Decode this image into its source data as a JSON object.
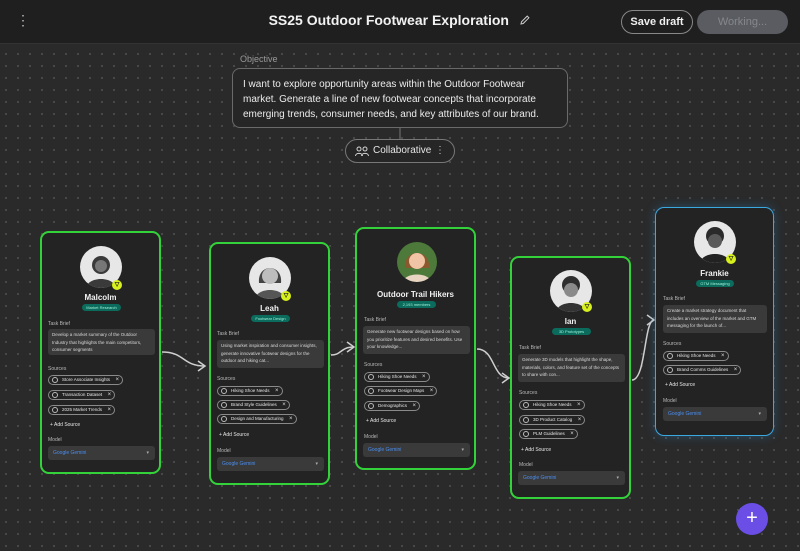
{
  "header": {
    "menu_icon": "more-vertical-icon",
    "title": "SS25 Outdoor Footwear Exploration",
    "edit_icon": "pencil-icon",
    "save_label": "Save draft",
    "working_label": "Working..."
  },
  "objective": {
    "label": "Objective",
    "text": "I want to explore opportunity areas within the Outdoor Footwear market. Generate a line of new footwear concepts that incorporate emerging trends, consumer needs, and  key attributes of our brand."
  },
  "mode": {
    "label": "Collaborative",
    "icon": "people-group-icon",
    "more_icon": "more-vertical-icon"
  },
  "labels": {
    "task_brief": "Task Brief",
    "sources": "Sources",
    "add_source": "+ Add Source",
    "model": "Model"
  },
  "agents": [
    {
      "name": "Malcolm",
      "role": "Market Research",
      "brief": "Develop a market summary of the Outdoor Industry that highlights the main competitors, consumer segments",
      "sources": [
        "Store Associate Insights",
        "Transaction Dataset",
        "2025 Market Trends"
      ],
      "model": "Google Gemini"
    },
    {
      "name": "Leah",
      "role": "Footwear Design",
      "brief": "Using market inspiration and consumer insights, generate innovative footwear designs for the outdoor and hiking cat...",
      "sources": [
        "Hiking Shoe Needs",
        "Brand Style Guidelines",
        "Design and Manufacturing"
      ],
      "model": "Google Gemini"
    },
    {
      "name": "Outdoor Trail Hikers",
      "role": "2,193 members",
      "brief": "Generate new footwear designs based on how you prioritize features and desired benefits. Use your knowledge...",
      "sources": [
        "Hiking Shoe Needs",
        "Footwear Design Maps",
        "Demographics"
      ],
      "model": "Google Gemini"
    },
    {
      "name": "Ian",
      "role": "3D Prototypes",
      "brief": "Generate 3D models that highlight the shape, materials, colors, and feature set of the concepts to share with con...",
      "sources": [
        "Hiking Shoe Needs",
        "3D Product Catalog",
        "PLM Guidelines"
      ],
      "model": "Google Gemini"
    },
    {
      "name": "Frankie",
      "role": "GTM Messaging",
      "brief": "Create a market strategy document that includes an overview of the market and GTM messaging for the launch of...",
      "sources": [
        "Hiking Shoe Needs",
        "Brand Comms Guidelines"
      ],
      "model": "Google Gemini"
    }
  ],
  "fab": {
    "label": "+"
  }
}
